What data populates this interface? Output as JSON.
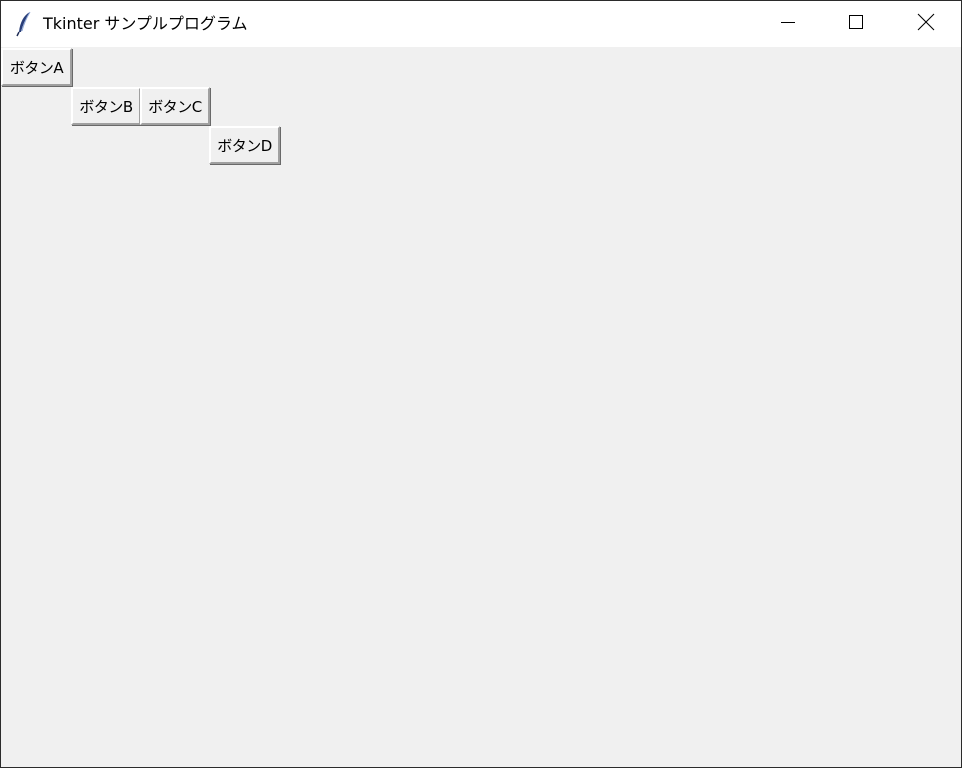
{
  "window": {
    "title": "Tkinter サンプルプログラム",
    "icon": "tk-feather-icon",
    "controls": {
      "minimize_icon": "minimize-icon",
      "maximize_icon": "maximize-icon",
      "close_icon": "close-icon"
    }
  },
  "buttons": {
    "a": {
      "label": "ボタンA"
    },
    "b": {
      "label": "ボタンB"
    },
    "c": {
      "label": "ボタンC"
    },
    "d": {
      "label": "ボタンD"
    }
  },
  "colors": {
    "titlebar_bg": "#ffffff",
    "client_bg": "#f0f0f0",
    "button_face": "#f0f0f0"
  }
}
